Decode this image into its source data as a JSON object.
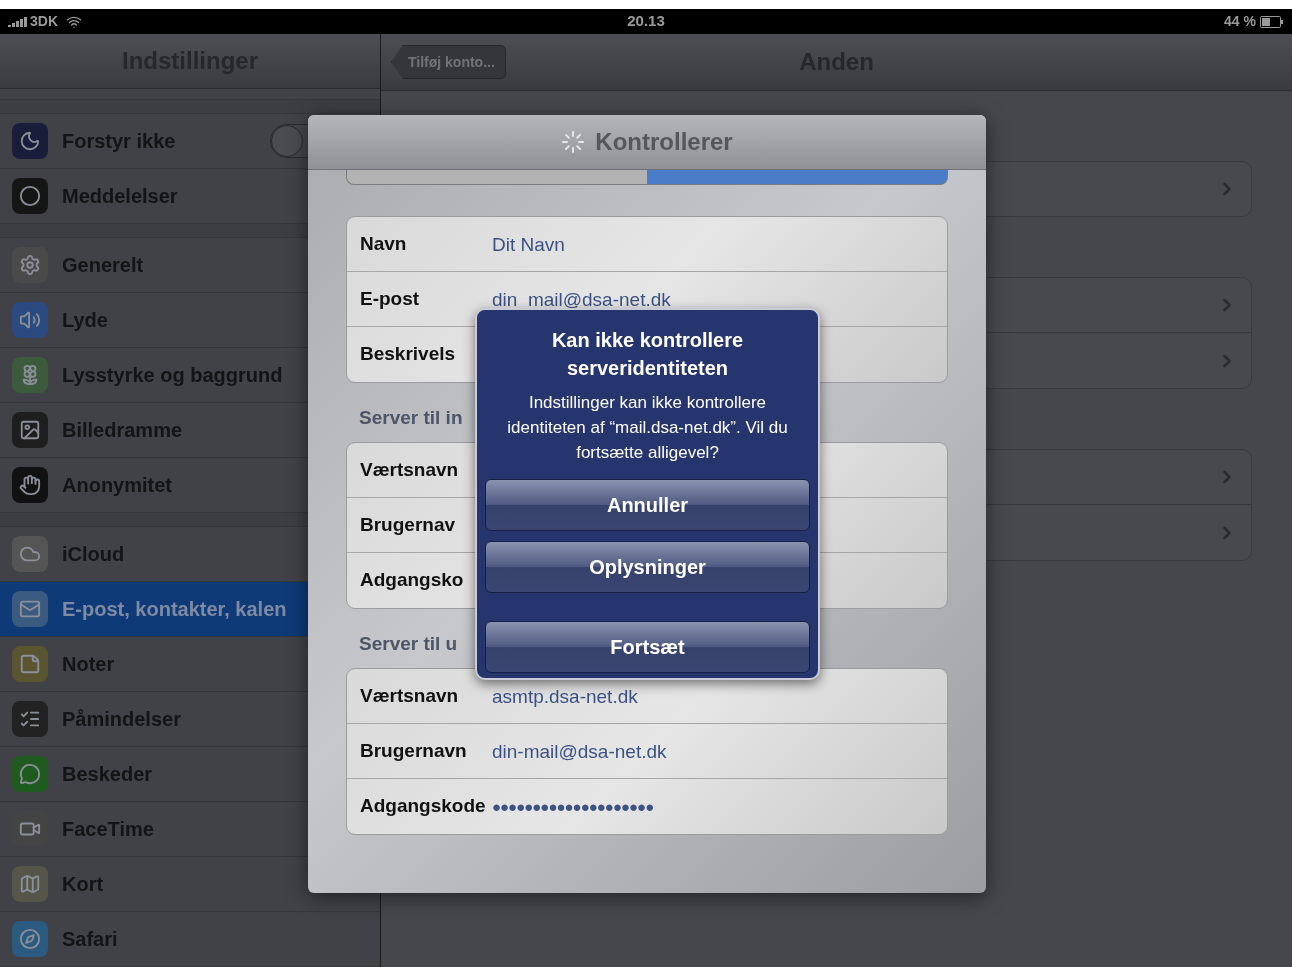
{
  "status_bar": {
    "carrier": "3DK",
    "time": "20.13",
    "battery": "44 %"
  },
  "sidebar": {
    "title": "Indstillinger",
    "groups": [
      [
        {
          "label": "Forstyr ikke",
          "kind": "toggle",
          "on": false,
          "selected": false
        },
        {
          "label": "Meddelelser",
          "kind": "link",
          "selected": false
        }
      ],
      [
        {
          "label": "Generelt",
          "kind": "link",
          "selected": false
        },
        {
          "label": "Lyde",
          "kind": "link",
          "selected": false
        },
        {
          "label": "Lysstyrke og baggrund",
          "kind": "link",
          "selected": false
        },
        {
          "label": "Billedramme",
          "kind": "link",
          "selected": false
        },
        {
          "label": "Anonymitet",
          "kind": "link",
          "selected": false
        }
      ],
      [
        {
          "label": "iCloud",
          "kind": "link",
          "selected": false
        },
        {
          "label": "E-post, kontakter, kalen",
          "kind": "link",
          "selected": true
        },
        {
          "label": "Noter",
          "kind": "link",
          "selected": false
        },
        {
          "label": "Påmindelser",
          "kind": "link",
          "selected": false
        },
        {
          "label": "Beskeder",
          "kind": "link",
          "selected": false
        },
        {
          "label": "FaceTime",
          "kind": "link",
          "selected": false
        },
        {
          "label": "Kort",
          "kind": "link",
          "selected": false
        },
        {
          "label": "Safari",
          "kind": "link",
          "selected": false
        }
      ]
    ]
  },
  "detail": {
    "back_button": "Tilføj konto...",
    "title": "Anden"
  },
  "sheet": {
    "title": "Kontrollerer",
    "segments": [
      {
        "selected": false
      },
      {
        "selected": true
      }
    ],
    "groups": [
      {
        "rows": [
          {
            "label": "Navn",
            "value": "Dit Navn",
            "kind": "text"
          },
          {
            "label": "E-post",
            "value": "din_mail@dsa-net.dk",
            "kind": "text"
          },
          {
            "label": "Beskrivels"
          }
        ]
      },
      {
        "header": "Server til in",
        "rows": [
          {
            "label": "Værtsnavn"
          },
          {
            "label": "Brugernav"
          },
          {
            "label": "Adgangsko"
          }
        ]
      },
      {
        "header": "Server til u",
        "rows": [
          {
            "label": "Værtsnavn",
            "value": "asmtp.dsa-net.dk",
            "kind": "text"
          },
          {
            "label": "Brugernavn",
            "value": "din-mail@dsa-net.dk",
            "kind": "text"
          },
          {
            "label": "Adgangskode",
            "value": "●●●●●●●●●●●●●●●●●●●●",
            "kind": "password"
          }
        ]
      }
    ]
  },
  "alert": {
    "title": "Kan ikke kontrollere serveridentiteten",
    "message": "Indstillinger kan ikke kontrollere identiteten af “mail.dsa-net.dk”. Vil du fortsætte alligevel?",
    "buttons": [
      {
        "label": "Annuller",
        "kind": "normal"
      },
      {
        "label": "Oplysninger",
        "kind": "normal"
      },
      {
        "label": "Fortsæt",
        "kind": "separated"
      }
    ]
  }
}
